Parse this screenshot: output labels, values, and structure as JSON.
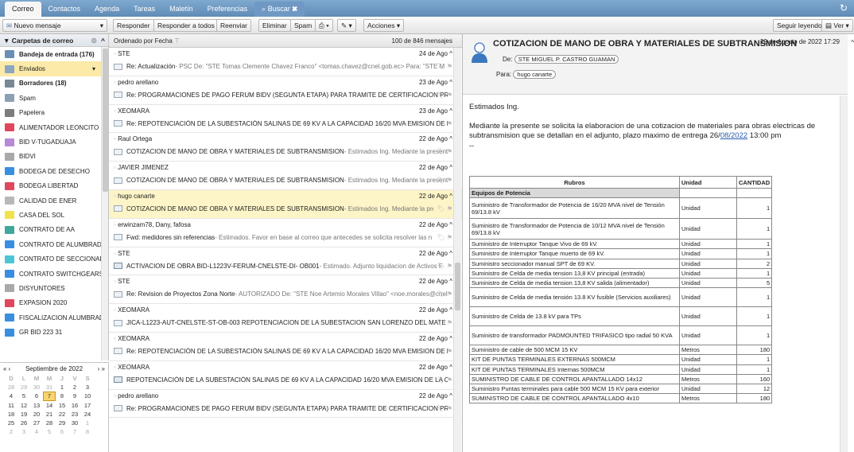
{
  "tabs": {
    "correo": "Correo",
    "contactos": "Contactos",
    "agenda": "Agenda",
    "tareas": "Tareas",
    "maletin": "Maletín",
    "preferencias": "Preferencias",
    "buscar": "Buscar"
  },
  "toolbar": {
    "new_message": "Nuevo mensaje",
    "reply": "Responder",
    "reply_all": "Responder a todos",
    "forward": "Reenviar",
    "delete": "Eliminar",
    "spam": "Spam",
    "actions": "Acciones",
    "keep_reading": "Seguir leyendo",
    "view": "Ver"
  },
  "sidebar": {
    "title": "Carpetas de correo",
    "folders": [
      {
        "label": "Bandeja de entrada (176)",
        "bold": true,
        "color": "#6a8fb5"
      },
      {
        "label": "Enviados",
        "sel": true,
        "color": "#8aa6c2"
      },
      {
        "label": "Borradores (18)",
        "bold": true,
        "color": "#7a8794"
      },
      {
        "label": "Spam",
        "color": "#8da0b3"
      },
      {
        "label": "Papelera",
        "color": "#7d7d7d"
      },
      {
        "label": "ALIMENTADOR LEONCITO",
        "color": "#e0475a"
      },
      {
        "label": "BID V-TUGADUAJA",
        "color": "#b889d8"
      },
      {
        "label": "BIDVI",
        "color": "#a9a9a9"
      },
      {
        "label": "BODEGA DE DESECHO",
        "color": "#3a8ee0"
      },
      {
        "label": "BODEGA LIBERTAD",
        "color": "#e0475a"
      },
      {
        "label": "CALIDAD DE ENER",
        "color": "#b8b8b8"
      },
      {
        "label": "CASA DEL SOL",
        "color": "#f2e24c"
      },
      {
        "label": "CONTRATO DE AA",
        "color": "#3fa89a"
      },
      {
        "label": "CONTRATO DE ALUMBRAD",
        "color": "#3a8ee0"
      },
      {
        "label": "CONTRATO DE SECCIONAD",
        "color": "#4cc6d6"
      },
      {
        "label": "CONTRATO SWITCHGEARS",
        "color": "#3a8ee0"
      },
      {
        "label": "DISYUNTORES",
        "color": "#a9a9a9"
      },
      {
        "label": "EXPASION 2020",
        "color": "#e0475a"
      },
      {
        "label": "FISCALIZACION ALUMBRAD",
        "color": "#3a8ee0"
      },
      {
        "label": "GR BID 223 31",
        "color": "#3a8ee0"
      }
    ]
  },
  "calendar": {
    "month": "Septiembre de 2022",
    "dow": [
      "D",
      "L",
      "M",
      "M",
      "J",
      "V",
      "S"
    ],
    "weeks": [
      [
        "28",
        "29",
        "30",
        "31",
        "1",
        "2",
        "3"
      ],
      [
        "4",
        "5",
        "6",
        "7",
        "8",
        "9",
        "10"
      ],
      [
        "11",
        "12",
        "13",
        "14",
        "15",
        "16",
        "17"
      ],
      [
        "18",
        "19",
        "20",
        "21",
        "22",
        "23",
        "24"
      ],
      [
        "25",
        "26",
        "27",
        "28",
        "29",
        "30",
        "1"
      ],
      [
        "2",
        "3",
        "4",
        "5",
        "6",
        "7",
        "8"
      ]
    ],
    "today": "7"
  },
  "list": {
    "sort": "Ordenado por Fecha",
    "count": "100 de 846 mensajes",
    "messages": [
      {
        "from": "STE",
        "date": "24 de Ago",
        "subject": "Re: Actualización",
        "snippet": " - PSC De: \"STE Tomas Clemente Chavez Franco\" <tomas.chavez@cnel.gob.ec> Para: \"STE M"
      },
      {
        "from": "pedro arellano",
        "date": "23 de Ago",
        "subject": "Re: PROGRAMACIONES DE PAGO FERUM BIDV (SEGUNTA ETAPA) PARA TRAMITE DE CERTIFICACION PRESUPL",
        "snippet": ""
      },
      {
        "from": "XEOMARA",
        "date": "23 de Ago",
        "subject": "Re: REPOTENCIACIÓN DE LA SUBESTACIÓN SALINAS DE 69 KV A LA CAPACIDAD 16/20 MVA EMISION DE LA CERTIF",
        "snippet": ""
      },
      {
        "from": "Raul Ortega",
        "date": "22 de Ago",
        "subject": "COTIZACION DE MANO DE OBRA Y MATERIALES DE SUBTRANSMISION",
        "snippet": " - Estimados Ing. Mediante la presente se s"
      },
      {
        "from": "JAVIER JIMENEZ",
        "date": "22 de Ago",
        "subject": "COTIZACION DE MANO DE OBRA Y MATERIALES DE SUBTRANSMISION",
        "snippet": " - Estimados Ing. Mediante la presente se s"
      },
      {
        "from": "hugo canarte",
        "date": "22 de Ago",
        "subject": "COTIZACION DE MANO DE OBRA Y MATERIALES DE SUBTRANSMISION",
        "snippet": " - Estimados Ing. Mediante la presente se s",
        "sel": true
      },
      {
        "from": "erwinzam78, Dany, fafosa",
        "date": "22 de Ago",
        "subject": "Fwd: medidores sin referencias",
        "snippet": " - Estimados. Favor en base al correo que antecedes se solicita resolver las n"
      },
      {
        "from": "STE",
        "date": "22 de Ago",
        "subject": "ACTIVACION DE OBRA BID-L1223V-FERUM-CNELSTE-DI- OB001",
        "snippet": " - Estimado. Adjunto liquidacion de Activos F",
        "att": true
      },
      {
        "from": "STE",
        "date": "22 de Ago",
        "subject": "Re: Revision de Proyectos Zona Norte",
        "snippet": " - AUTORIZADO De: \"STE Noe Artemio Morales Villao\" <noe.morales@cnel"
      },
      {
        "from": "XEOMARA",
        "date": "22 de Ago",
        "subject": "JICA-L1223-AUT-CNELSTE-ST-OB-003 REPOTENCIACION DE LA SUBESTACION SAN LORENZO DEL MATE EMISI",
        "snippet": ""
      },
      {
        "from": "XEOMARA",
        "date": "22 de Ago",
        "subject": "Re: REPOTENCIACIÓN DE LA SUBESTACIÓN SALINAS DE 69 KV A LA CAPACIDAD 16/20 MVA EMISION DE LA CE",
        "snippet": ""
      },
      {
        "from": "XEOMARA",
        "date": "22 de Ago",
        "subject": "REPOTENCIACIÓN DE LA SUBESTACIÓN SALINAS DE 69 KV A LA CAPACIDAD 16/20 MVA EMISION DE LA CERTI",
        "snippet": "",
        "att": true
      },
      {
        "from": "pedro arellano",
        "date": "22 de Ago",
        "subject": "Re: PROGRAMACIONES DE PAGO FERUM BIDV (SEGUNTA ETAPA) PARA TRAMITE DE CERTIFICACION PRESUPL",
        "snippet": ""
      }
    ]
  },
  "reading": {
    "subject": "COTIZACION DE MANO DE OBRA Y MATERIALES DE SUBTRANSMISION",
    "date": "22 de Agosto de 2022 17:29",
    "from_label": "De:",
    "from": "STE MIGUEL P. CASTRO GUAMAN",
    "to_label": "Para:",
    "to": "hugo canarte",
    "greeting": "Estimados Ing.",
    "body_pre": "Mediante la presente se solicita la elaboracion de una cotizacion de materiales para obras electricas de subtransmision que se detallan en el adjunto, plazo maximo de entrega 26/",
    "body_link": "08/2022",
    "body_post": " 13:00 pm",
    "sig": "--"
  },
  "table": {
    "headers": [
      "Rubros",
      "Unidad",
      "CANTIDAD"
    ],
    "section": "Equipos de Potencia",
    "rows": [
      {
        "r": "Suministro de Transformador de Potencia de 16/20 MVA nivel de Tensión 69/13.8 kV",
        "u": "Unidad",
        "c": "1",
        "h": "r2"
      },
      {
        "r": "Suministro de Transformador de Potencia de 10/12 MVA nivel de Tensión 69/13.8 kV",
        "u": "Unidad",
        "c": "1",
        "h": "r2"
      },
      {
        "r": "Suministro de Interruptor Tanque Vivo de 69 kV.",
        "u": "Unidad",
        "c": "1",
        "h": "r1"
      },
      {
        "r": "Suministro de Interruptor Tanque muerto de 69 kV.",
        "u": "Unidad",
        "c": "1",
        "h": "r1"
      },
      {
        "r": "Suministro seccionador manual SPT de 69 KV.",
        "u": "Unidad",
        "c": "2",
        "h": "r1"
      },
      {
        "r": "Suministro de Celda de media tension 13,8 KV principal (entrada)",
        "u": "Unidad",
        "c": "1",
        "h": "r1"
      },
      {
        "r": "Suministro de Celda de media tension 13,8 KV salida (alimentador)",
        "u": "Unidad",
        "c": "5",
        "h": "r1"
      },
      {
        "r": "Suministro de Celda de media tensión 13.8 KV fusible (Servicios auxiliares)",
        "u": "Unidad",
        "c": "1",
        "h": "r2h"
      },
      {
        "r": "Suministro de Celda de 13.8 kV para TPs",
        "u": "Unidad",
        "c": "1",
        "h": "r2h"
      },
      {
        "r": "Suministro de transformador PADMOUNTED TRIFASICO tipo radial 50 KVA",
        "u": "Unidad",
        "c": "1",
        "h": "r2h"
      },
      {
        "r": "Suministro de cable de 500 MCM 15 KV",
        "u": "Metros",
        "c": "180",
        "h": "r1"
      },
      {
        "r": "KIT DE PUNTAS TERMINALES EXTERNAS 500MCM",
        "u": "Unidad",
        "c": "1",
        "h": "r1"
      },
      {
        "r": "KIT DE PUNTAS TERMINALES Internas 500MCM",
        "u": "Unidad",
        "c": "1",
        "h": "r1"
      },
      {
        "r": "SUMINISTRO DE CABLE DE CONTROL APANTALLADO 14x12",
        "u": "Metros",
        "c": "160",
        "h": "r1"
      },
      {
        "r": "Suministro Puntas terminales para cable 500 MCM 15 KV para exterior",
        "u": "Unidad",
        "c": "12",
        "h": "r1"
      },
      {
        "r": "SUMINISTRO DE CABLE DE CONTROL APANTALLADO 4x10",
        "u": "Metros",
        "c": "180",
        "h": "r1"
      }
    ]
  }
}
